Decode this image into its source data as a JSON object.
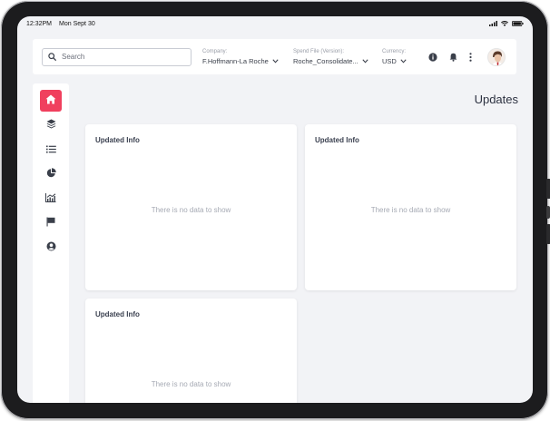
{
  "statusbar": {
    "time": "12:32PM",
    "date": "Mon Sept 30"
  },
  "search": {
    "placeholder": "Search",
    "value": ""
  },
  "filters": {
    "company_label": "Company:",
    "company_value": "F.Hoffmann-La Roche",
    "spend_label": "Spend File (Version):",
    "spend_value": "Roche_Consolidate...",
    "currency_label": "Currency:",
    "currency_value": "USD"
  },
  "sidebar": {
    "items": [
      {
        "icon": "home-icon",
        "active": true
      },
      {
        "icon": "layers-icon",
        "active": false
      },
      {
        "icon": "list-icon",
        "active": false
      },
      {
        "icon": "pie-chart-icon",
        "active": false
      },
      {
        "icon": "analytics-icon",
        "active": false
      },
      {
        "icon": "flag-icon",
        "active": false
      },
      {
        "icon": "user-icon",
        "active": false
      }
    ]
  },
  "page": {
    "title": "Updates"
  },
  "cards": [
    {
      "title": "Updated Info",
      "empty_text": "There is no data to show"
    },
    {
      "title": "Updated Info",
      "empty_text": "There is no data to show"
    },
    {
      "title": "Updated Info",
      "empty_text": "There is no data to show"
    }
  ],
  "colors": {
    "accent": "#f0405e",
    "background": "#f2f3f6",
    "device_frame": "#1c1c1e"
  }
}
